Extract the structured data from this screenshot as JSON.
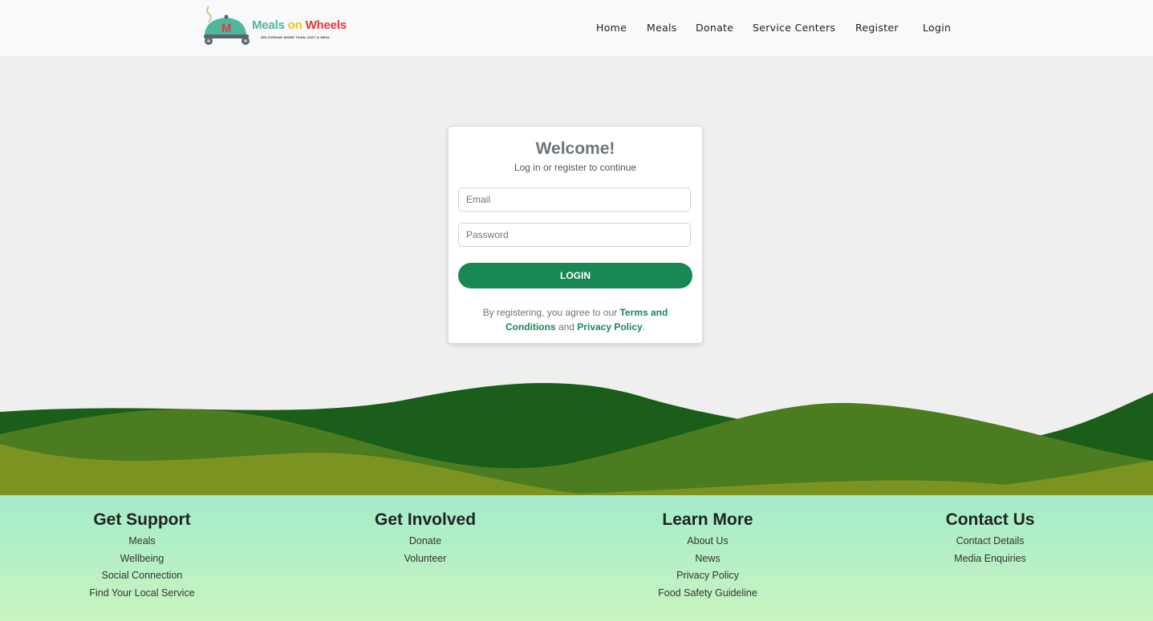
{
  "brand": {
    "logo_letter": "M",
    "name_part1": "Meals",
    "name_part2": "on",
    "name_part3": "Wheels",
    "tagline": "DELIVERING MORE THAN JUST A MEAL"
  },
  "nav": {
    "items": [
      "Home",
      "Meals",
      "Donate",
      "Service Centers",
      "Register",
      "Login"
    ]
  },
  "login": {
    "title": "Welcome!",
    "subtitle": "Log in or register to continue",
    "email_placeholder": "Email",
    "password_placeholder": "Password",
    "button_label": "LOGIN",
    "terms_prefix": "By registering, you agree to our ",
    "terms_link": "Terms and Conditions",
    "terms_and": " and ",
    "privacy_link": "Privacy Policy",
    "terms_suffix": "."
  },
  "colors": {
    "accent_green": "#198754",
    "hill_dark": "#1a5e1a",
    "hill_mid": "#4b7c1f",
    "hill_light": "#7b9421",
    "footer_top": "#a3ecca",
    "footer_bottom": "#c9f4c0"
  },
  "footer": {
    "columns": [
      {
        "heading": "Get Support",
        "links": [
          "Meals",
          "Wellbeing",
          "Social Connection",
          "Find Your Local Service"
        ]
      },
      {
        "heading": "Get Involved",
        "links": [
          "Donate",
          "Volunteer"
        ]
      },
      {
        "heading": "Learn More",
        "links": [
          "About Us",
          "News",
          "Privacy Policy",
          "Food Safety Guideline"
        ]
      },
      {
        "heading": "Contact Us",
        "links": [
          "Contact Details",
          "Media Enquiries"
        ]
      }
    ]
  }
}
